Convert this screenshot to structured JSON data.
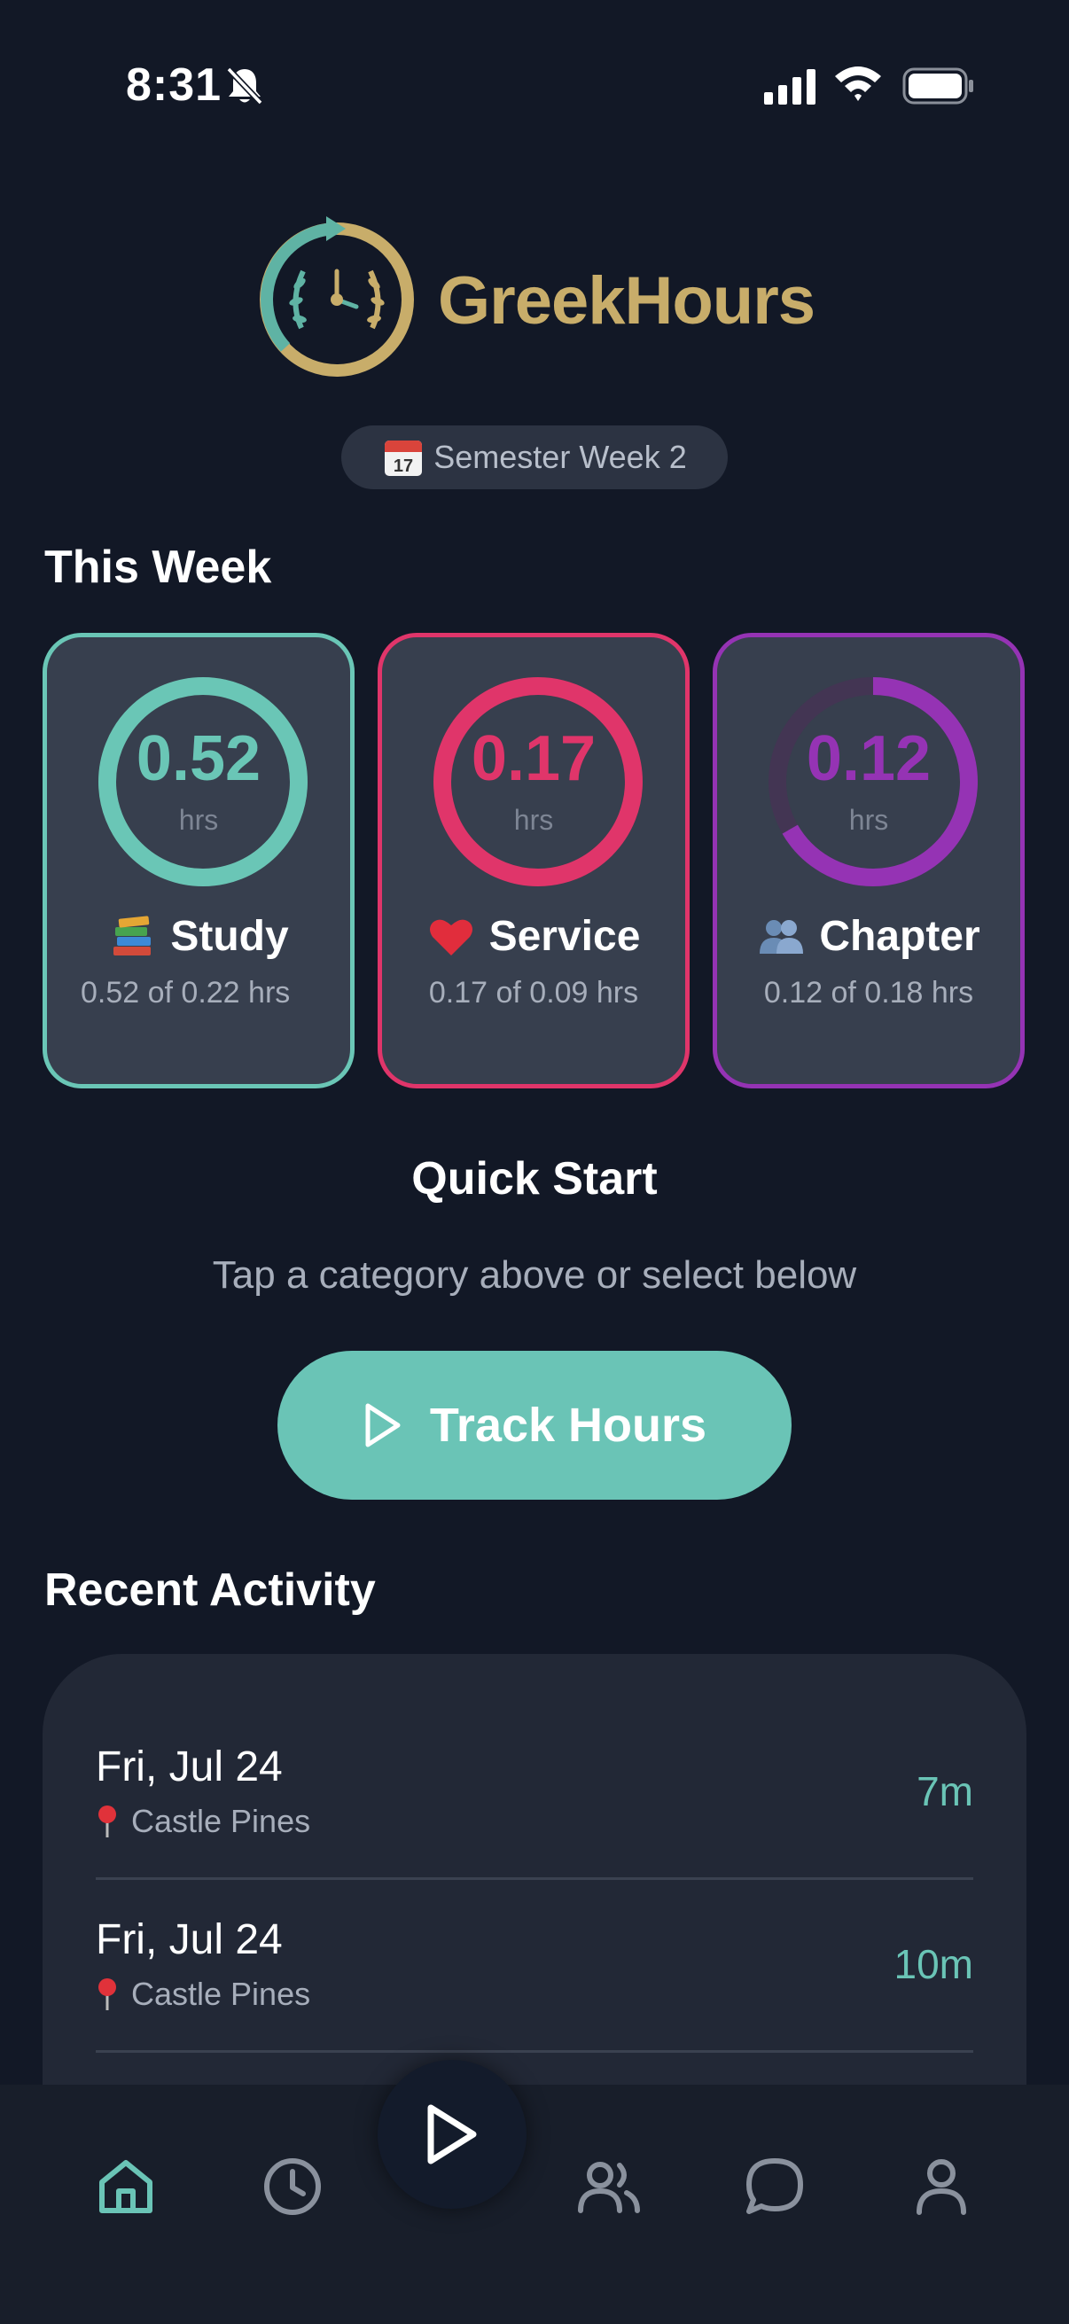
{
  "status_bar": {
    "time": "8:31"
  },
  "logo": {
    "name": "GreekHours"
  },
  "week_pill": {
    "label": "Semester Week 2"
  },
  "this_week": {
    "title": "This Week",
    "categories": [
      {
        "key": "study",
        "emoji": "books-emoji",
        "label": "Study",
        "value": "0.52",
        "unit": "hrs",
        "progress_text": "0.52 of 0.22 hrs",
        "fraction": 1.0,
        "color": "#6ac6b6"
      },
      {
        "key": "service",
        "emoji": "heart-emoji",
        "label": "Service",
        "value": "0.17",
        "unit": "hrs",
        "progress_text": "0.17 of 0.09 hrs",
        "fraction": 1.0,
        "color": "#e0356a"
      },
      {
        "key": "chapter",
        "emoji": "people-emoji",
        "label": "Chapter",
        "value": "0.12",
        "unit": "hrs",
        "progress_text": "0.12 of 0.18 hrs",
        "fraction": 0.667,
        "color": "#9533b4"
      }
    ]
  },
  "quick_start": {
    "title": "Quick Start",
    "subtitle": "Tap a category above or select below",
    "button_label": "Track Hours"
  },
  "recent_activity": {
    "title": "Recent Activity",
    "items": [
      {
        "date": "Fri, Jul 24",
        "location": "Castle Pines",
        "duration": "7m"
      },
      {
        "date": "Fri, Jul 24",
        "location": "Castle Pines",
        "duration": "10m"
      }
    ]
  },
  "bottom_nav": {
    "items": [
      "home-icon",
      "clock-icon",
      "play-icon",
      "people-icon",
      "chat-icon",
      "profile-icon"
    ],
    "active": "home-icon"
  },
  "colors": {
    "background": "#121826",
    "accent": "#6ac4b6",
    "service": "#e0356a",
    "chapter": "#9533b4",
    "gold": "#c8ad6a"
  }
}
